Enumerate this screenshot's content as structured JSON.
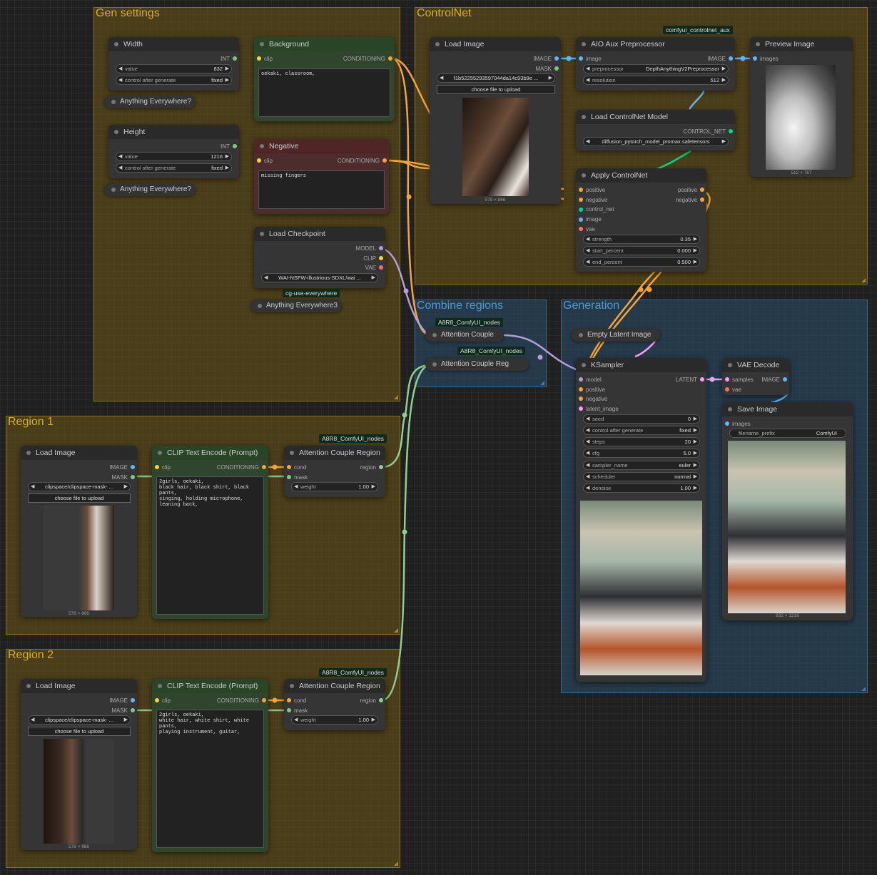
{
  "colors": {
    "clip": "#f6d53c",
    "conditioning": "#f5a33a",
    "model": "#b39ddb",
    "image": "#64b5f6",
    "mask": "#81c784",
    "vae": "#ff6e6e",
    "latent": "#ff9cf9",
    "region": "#8fcf8f",
    "control_net": "#00d68f"
  },
  "groups": {
    "gen_settings": "Gen settings",
    "controlnet": "ControlNet",
    "combine": "Combine regions",
    "generation": "Generation",
    "region1": "Region 1",
    "region2": "Region 2"
  },
  "badges": {
    "cn_aux": "comfyui_controlnet_aux",
    "a8r8_1": "A8R8_ComfyUI_nodes",
    "a8r8_2": "A8R8_ComfyUI_nodes",
    "a8r8_r1": "A8R8_ComfyUI_nodes",
    "a8r8_r2": "A8R8_ComfyUI_nodes",
    "cg_use": "cg-use-everywhere"
  },
  "width": {
    "title": "Width",
    "out": "INT",
    "value_label": "value",
    "value": "832",
    "cag_label": "control after generate",
    "cag": "fixed"
  },
  "height": {
    "title": "Height",
    "out": "INT",
    "value_label": "value",
    "value": "1216",
    "cag_label": "control after generate",
    "cag": "fixed"
  },
  "anything": {
    "a1": "Anything Everywhere?",
    "a2": "Anything Everywhere?",
    "a3": "Anything Everywhere3"
  },
  "background": {
    "title": "Background",
    "in": "clip",
    "out": "CONDITIONING",
    "text": "oekaki, classroom,"
  },
  "negative": {
    "title": "Negative",
    "in": "clip",
    "out": "CONDITIONING",
    "text": "missing fingers"
  },
  "checkpoint": {
    "title": "Load Checkpoint",
    "o1": "MODEL",
    "o2": "CLIP",
    "o3": "VAE",
    "ckpt": "WAI-NSFW-illustrious-SDXL/wai ..."
  },
  "cn_load_image": {
    "title": "Load Image",
    "o1": "IMAGE",
    "o2": "MASK",
    "file": "f1b52255293597044da14c93b9e ...",
    "upload": "choose file to upload",
    "size": "578 × 866"
  },
  "aio": {
    "title": "AIO Aux Preprocessor",
    "in": "image",
    "out": "IMAGE",
    "pre_label": "preprocessor",
    "pre": "DepthAnythingV2Preprocessor",
    "res_label": "resolution",
    "res": "512"
  },
  "preview": {
    "title": "Preview Image",
    "in": "images",
    "size": "512 × 767"
  },
  "cn_model": {
    "title": "Load ControlNet Model",
    "out": "CONTROL_NET",
    "file": "diffusion_pytorch_model_promax.safetensors"
  },
  "apply_cn": {
    "title": "Apply ControlNet",
    "i1": "positive",
    "i2": "negative",
    "i3": "control_net",
    "i4": "image",
    "i5": "vae",
    "o1": "positive",
    "o2": "negative",
    "w1l": "strength",
    "w1": "0.35",
    "w2l": "start_percent",
    "w2": "0.000",
    "w3l": "end_percent",
    "w3": "0.500"
  },
  "att_couple": {
    "title": "Attention Couple"
  },
  "att_reg": {
    "title": "Attention Couple Reg"
  },
  "empty_latent": {
    "title": "Empty Latent Image"
  },
  "ksampler": {
    "title": "KSampler",
    "i1": "model",
    "i2": "positive",
    "i3": "negative",
    "i4": "latent_image",
    "out": "LATENT",
    "seed_l": "seed",
    "seed": "0",
    "cag_l": "control after generate",
    "cag": "fixed",
    "steps_l": "steps",
    "steps": "20",
    "cfg_l": "cfg",
    "cfg": "5.0",
    "sampler_l": "sampler_name",
    "sampler": "euler",
    "sched_l": "scheduler",
    "sched": "normal",
    "den_l": "denoise",
    "den": "1.00"
  },
  "vae_decode": {
    "title": "VAE Decode",
    "i1": "samples",
    "i2": "vae",
    "out": "IMAGE"
  },
  "save": {
    "title": "Save Image",
    "in": "images",
    "prefix_l": "filename_prefix",
    "prefix": "ComfyUI",
    "size": "832 × 1216"
  },
  "r1": {
    "load_title": "Load Image",
    "o1": "IMAGE",
    "o2": "MASK",
    "file": "clipspace/clipspace-mask- ...",
    "upload": "choose file to upload",
    "size": "578 × 866",
    "clip_title": "CLIP Text Encode (Prompt)",
    "clip_in": "clip",
    "clip_out": "CONDITIONING",
    "text": "2girls, oekaki,\nblack hair, black shirt, black pants,\nsinging, holding microphone,\nleaning back,",
    "acr_title": "Attention Couple Region",
    "acr_i1": "cond",
    "acr_i2": "mask",
    "acr_out": "region",
    "w_l": "weight",
    "w": "1.00"
  },
  "r2": {
    "load_title": "Load Image",
    "o1": "IMAGE",
    "o2": "MASK",
    "file": "clipspace/clipspace-mask- ...",
    "upload": "choose file to upload",
    "size": "578 × 866",
    "clip_title": "CLIP Text Encode (Prompt)",
    "clip_in": "clip",
    "clip_out": "CONDITIONING",
    "text": "2girls, oekaki,\nwhite hair, white shirt, white pants,\nplaying instrument, guitar,",
    "acr_title": "Attention Couple Region",
    "acr_i1": "cond",
    "acr_i2": "mask",
    "acr_out": "region",
    "w_l": "weight",
    "w": "1.00"
  }
}
